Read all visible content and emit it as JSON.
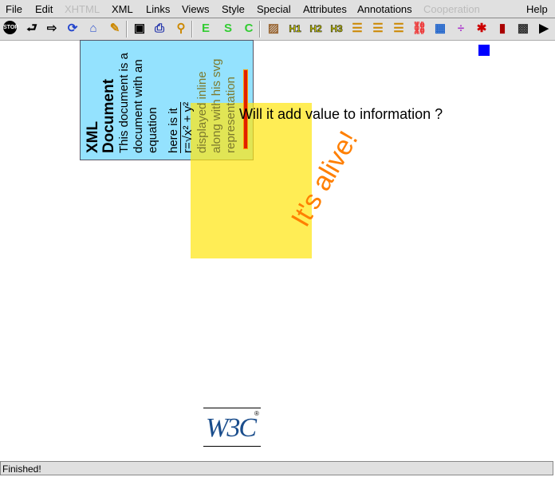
{
  "menu": [
    "File",
    "Edit",
    "XHTML",
    "XML",
    "Links",
    "Views",
    "Style",
    "Special",
    "Attributes",
    "Annotations",
    "Cooperation",
    "Help"
  ],
  "menu_disabled": [
    "XHTML",
    "Cooperation"
  ],
  "toolbar": [
    "stop-icon",
    "back-icon",
    "forward-icon",
    "reload-icon",
    "home-icon",
    "edit-icon",
    "save-icon",
    "print-icon",
    "find-icon",
    "emphasis-icon",
    "strong-icon",
    "code-icon",
    "image-icon",
    "h1-icon",
    "h2-icon",
    "h3-icon",
    "bulleted-list-icon",
    "numbered-list-icon",
    "definition-list-icon",
    "link-icon",
    "table-icon",
    "math-icon",
    "svg-icon",
    "chart-icon",
    "movie-icon",
    "play-icon"
  ],
  "doc": {
    "box_title": "XML Document",
    "box_text": "This document is a document with an equation",
    "eq_label": "here is it",
    "eq": "r=√x² + y²",
    "box_text2": "displayed inline along with his svg representation",
    "question": "Will it add value to information ?",
    "alive": "It's alive!",
    "logo": "W3C"
  },
  "status": "Finished!"
}
